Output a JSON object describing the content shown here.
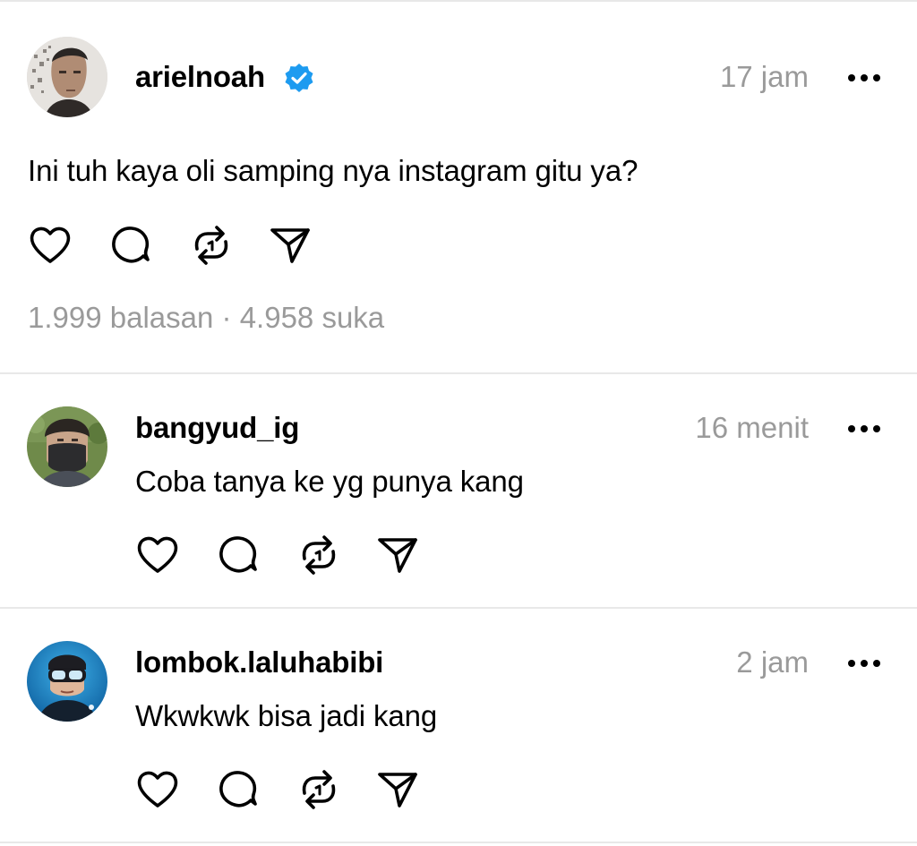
{
  "colors": {
    "text": "#000000",
    "muted": "#9a9a9a",
    "divider": "#e8e8e8",
    "verified": "#1d9bf0"
  },
  "icons": [
    "heart-icon",
    "comment-icon",
    "repost-icon",
    "share-icon",
    "more-icon",
    "verified-icon"
  ],
  "main_post": {
    "username": "arielnoah",
    "time": "17 jam",
    "text": "Ini tuh kaya oli samping nya instagram gitu ya?",
    "replies": "1.999 balasan",
    "separator": "·",
    "likes": "4.958 suka"
  },
  "replies": [
    {
      "username": "bangyud_ig",
      "time": "16 menit",
      "text": "Coba tanya ke yg punya kang"
    },
    {
      "username": "lombok.laluhabibi",
      "time": "2 jam",
      "text": "Wkwkwk bisa jadi kang"
    }
  ]
}
